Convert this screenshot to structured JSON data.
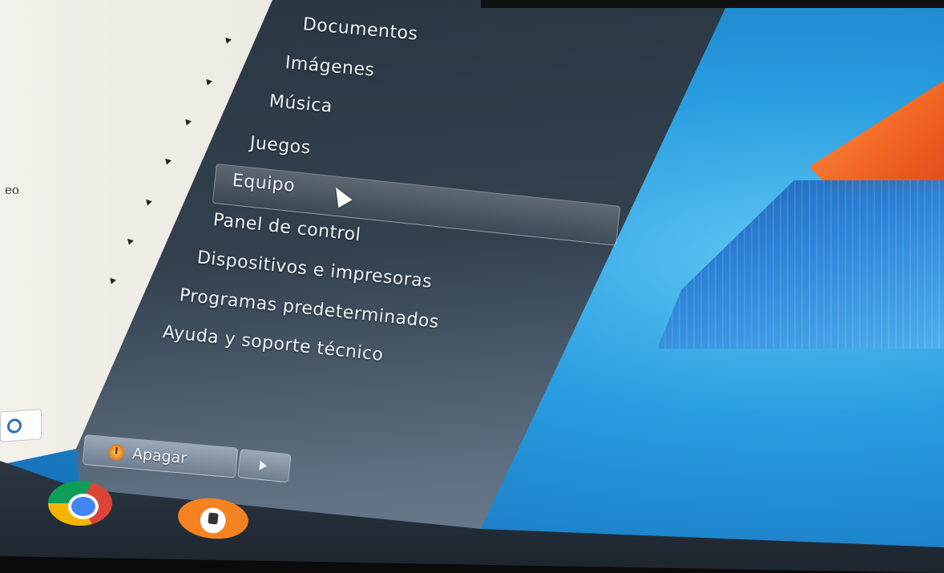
{
  "left_pane": {
    "fragment_text": "eo",
    "arrows": 7
  },
  "menu": {
    "items": [
      {
        "label": "Documentos"
      },
      {
        "label": "Imágenes"
      },
      {
        "label": "Música"
      },
      {
        "label": "Juegos"
      },
      {
        "label": "Equipo"
      },
      {
        "label": "Panel de control"
      },
      {
        "label": "Dispositivos e impresoras"
      },
      {
        "label": "Programas predeterminados"
      },
      {
        "label": "Ayuda y soporte técnico"
      }
    ],
    "selected": "Equipo"
  },
  "shutdown": {
    "label": "Apagar"
  },
  "taskbar": {
    "icons": [
      "chrome-icon",
      "app-icon"
    ]
  },
  "colors": {
    "menu_dark": "#33414f",
    "desktop_blue": "#2a9fe0",
    "logo_orange": "#f26522",
    "left_pane_bg": "#ebe8df"
  }
}
